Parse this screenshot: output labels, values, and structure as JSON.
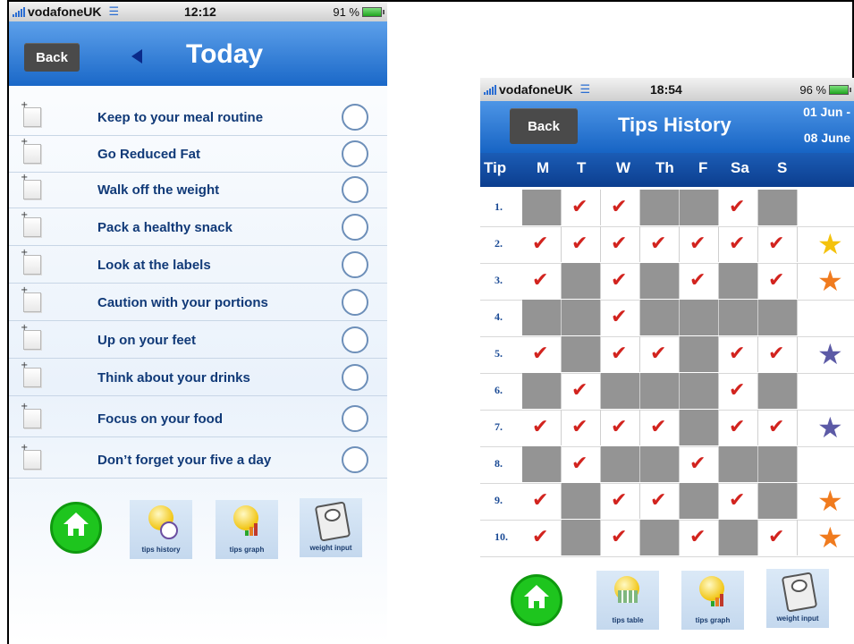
{
  "today_screen": {
    "status": {
      "carrier": "vodafoneUK",
      "time": "12:12",
      "battery": "91 %"
    },
    "back_label": "Back",
    "title": "Today",
    "tips": [
      "Keep to your meal routine",
      "Go Reduced Fat",
      "Walk off the weight",
      "Pack a healthy snack",
      "Look at the labels",
      "Caution with your portions",
      "Up on your feet",
      "Think about your drinks",
      "Focus on your food",
      "Don’t forget your five a day"
    ],
    "dock": {
      "tips_history": "tips history",
      "tips_graph": "tips graph",
      "weight_input": "weight input"
    }
  },
  "history_screen": {
    "status": {
      "carrier": "vodafoneUK",
      "time": "18:54",
      "battery": "96 %"
    },
    "back_label": "Back",
    "title": "Tips History",
    "date_from": "01 Jun -",
    "date_to": "08 June",
    "headers": [
      "Tip",
      "M",
      "T",
      "W",
      "Th",
      "F",
      "Sa",
      "S"
    ],
    "rows": [
      {
        "num": "1.",
        "cells": [
          "gray",
          "tick",
          "tick",
          "gray",
          "gray",
          "tick",
          "gray"
        ],
        "star": ""
      },
      {
        "num": "2.",
        "cells": [
          "tick",
          "tick",
          "tick",
          "tick",
          "tick",
          "tick",
          "tick"
        ],
        "star": "gold"
      },
      {
        "num": "3.",
        "cells": [
          "tick",
          "gray",
          "tick",
          "gray",
          "tick",
          "gray",
          "tick"
        ],
        "star": "orange"
      },
      {
        "num": "4.",
        "cells": [
          "gray",
          "gray",
          "tick",
          "gray",
          "gray",
          "gray",
          "gray"
        ],
        "star": ""
      },
      {
        "num": "5.",
        "cells": [
          "tick",
          "gray",
          "tick",
          "tick",
          "gray",
          "tick",
          "tick"
        ],
        "star": "purple"
      },
      {
        "num": "6.",
        "cells": [
          "gray",
          "tick",
          "gray",
          "gray",
          "gray",
          "tick",
          "gray"
        ],
        "star": ""
      },
      {
        "num": "7.",
        "cells": [
          "tick",
          "tick",
          "tick",
          "tick",
          "gray",
          "tick",
          "tick"
        ],
        "star": "purple"
      },
      {
        "num": "8.",
        "cells": [
          "gray",
          "tick",
          "gray",
          "gray",
          "tick",
          "gray",
          "gray"
        ],
        "star": ""
      },
      {
        "num": "9.",
        "cells": [
          "tick",
          "gray",
          "tick",
          "tick",
          "gray",
          "tick",
          "gray"
        ],
        "star": "orange"
      },
      {
        "num": "10.",
        "cells": [
          "tick",
          "gray",
          "tick",
          "gray",
          "tick",
          "gray",
          "tick"
        ],
        "star": "orange"
      }
    ],
    "dock": {
      "tips_table": "tips table",
      "tips_graph": "tips graph",
      "weight_input": "weight input"
    }
  },
  "colors": {
    "nav_blue": "#1a68c8",
    "tick_red": "#d2231e",
    "gray_cell": "#949494",
    "star_gold": "#f4c20d",
    "star_orange": "#f07b1e",
    "star_purple": "#5c5aa6"
  },
  "icons": {
    "tick": "✔",
    "star": "★"
  }
}
